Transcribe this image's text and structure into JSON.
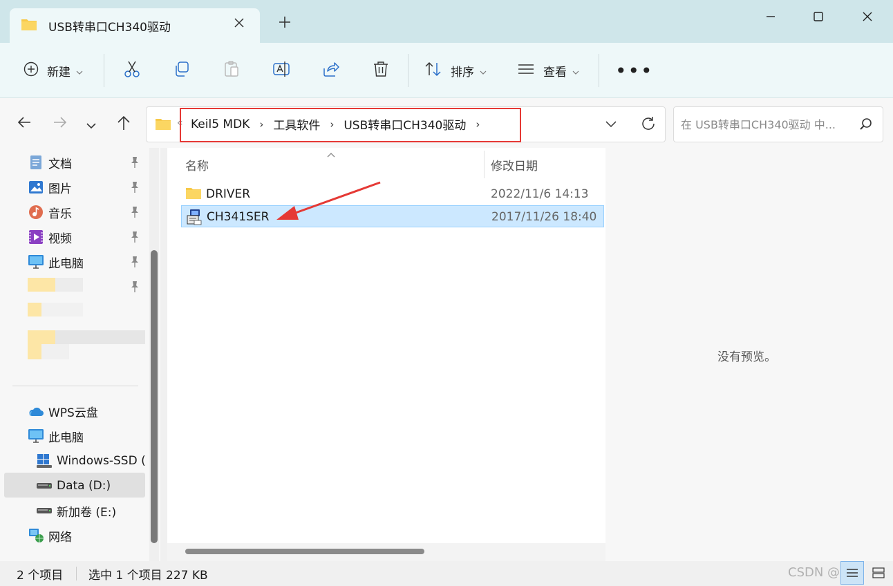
{
  "window": {
    "tab_title": "USB转串口CH340驱动",
    "new_tab_symbol": "+"
  },
  "ribbon": {
    "new_label": "新建",
    "sort_label": "排序",
    "view_label": "查看",
    "more_label": "•••"
  },
  "address": {
    "overflow_symbol": "«",
    "breadcrumbs": [
      "Keil5 MDK",
      "工具软件",
      "USB转串口CH340驱动"
    ],
    "separator": "›"
  },
  "search": {
    "placeholder": "在 USB转串口CH340驱动 中..."
  },
  "sidebar": {
    "pinned": [
      {
        "label": "文档",
        "icon": "document-icon"
      },
      {
        "label": "图片",
        "icon": "picture-icon"
      },
      {
        "label": "音乐",
        "icon": "music-icon"
      },
      {
        "label": "视频",
        "icon": "video-icon"
      },
      {
        "label": "此电脑",
        "icon": "computer-icon"
      }
    ],
    "locations": [
      {
        "label": "WPS云盘",
        "icon": "cloud-icon"
      },
      {
        "label": "此电脑",
        "icon": "computer-icon"
      },
      {
        "label": "Windows-SSD (",
        "icon": "windows-drive-icon"
      },
      {
        "label": "Data (D:)",
        "icon": "drive-icon",
        "selected": true
      },
      {
        "label": "新加卷 (E:)",
        "icon": "drive-icon"
      },
      {
        "label": "网络",
        "icon": "network-icon"
      }
    ]
  },
  "filelist": {
    "columns": {
      "name": "名称",
      "date": "修改日期"
    },
    "rows": [
      {
        "name": "DRIVER",
        "date": "2022/11/6 14:13",
        "icon": "folder-icon",
        "selected": false
      },
      {
        "name": "CH341SER",
        "date": "2017/11/26 18:40",
        "icon": "setup-exe-icon",
        "selected": true
      }
    ]
  },
  "preview": {
    "empty_text": "没有预览。"
  },
  "status": {
    "item_count": "2 个项目",
    "selection": "选中 1 个项目  227 KB"
  },
  "watermark": "CSDN @"
}
